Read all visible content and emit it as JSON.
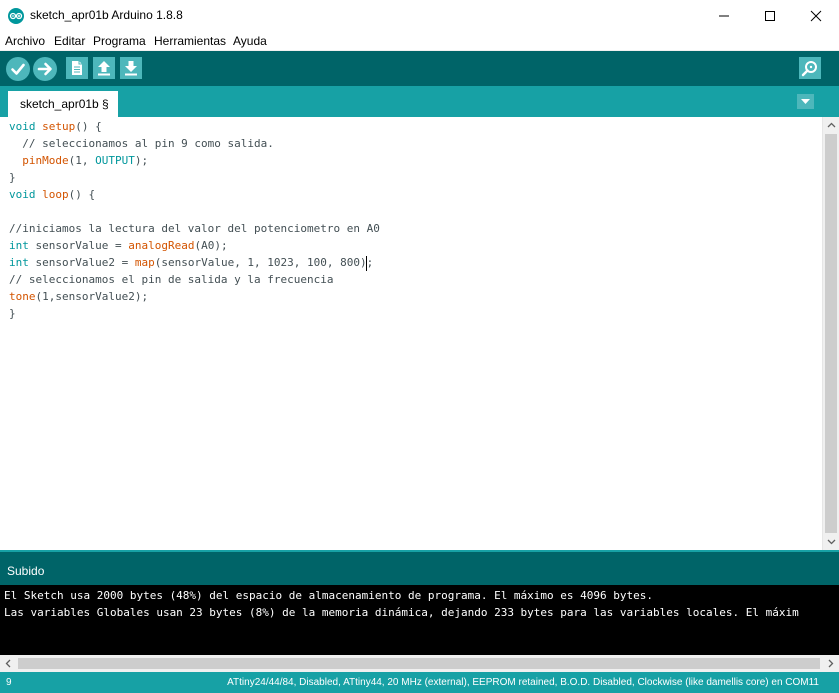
{
  "window": {
    "title": "sketch_apr01b Arduino 1.8.8"
  },
  "menu": {
    "items": [
      "Archivo",
      "Editar",
      "Programa",
      "Herramientas",
      "Ayuda"
    ]
  },
  "toolbar": {
    "buttons": [
      "verify-icon",
      "upload-icon",
      "new-icon",
      "open-icon",
      "save-icon"
    ],
    "right_button": "serial-monitor-icon"
  },
  "tabs": {
    "active": "sketch_apr01b §"
  },
  "editor": {
    "lines": [
      "void setup() {",
      "  // seleccionamos al pin 9 como salida.",
      "  pinMode(1, OUTPUT);",
      "}",
      "void loop() {",
      "",
      "//iniciamos la lectura del valor del potenciometro en A0",
      "int sensorValue = analogRead(A0);",
      "int sensorValue2 = map(sensorValue, 1, 1023, 100, 800);",
      "// seleccionamos el pin de salida y la frecuencia",
      "tone(1,sensorValue2);",
      "}"
    ]
  },
  "console": {
    "status": "Subido",
    "lines": [
      "El Sketch usa 2000 bytes (48%) del espacio de almacenamiento de programa. El máximo es 4096 bytes.",
      "Las variables Globales usan 23 bytes (8%) de la memoria dinámica, dejando 233 bytes para las variables locales. El máxim"
    ]
  },
  "statusbar": {
    "line_number": "9",
    "board": "ATtiny24/44/84, Disabled, ATtiny44, 20 MHz (external), EEPROM retained, B.O.D. Disabled, Clockwise (like damellis core) en COM11"
  },
  "colors": {
    "toolbar": "#006468",
    "tabbar": "#17a1a5",
    "button": "#4db7bb",
    "keyword": "#00979c",
    "function": "#d35400",
    "console_bg": "#000000"
  }
}
